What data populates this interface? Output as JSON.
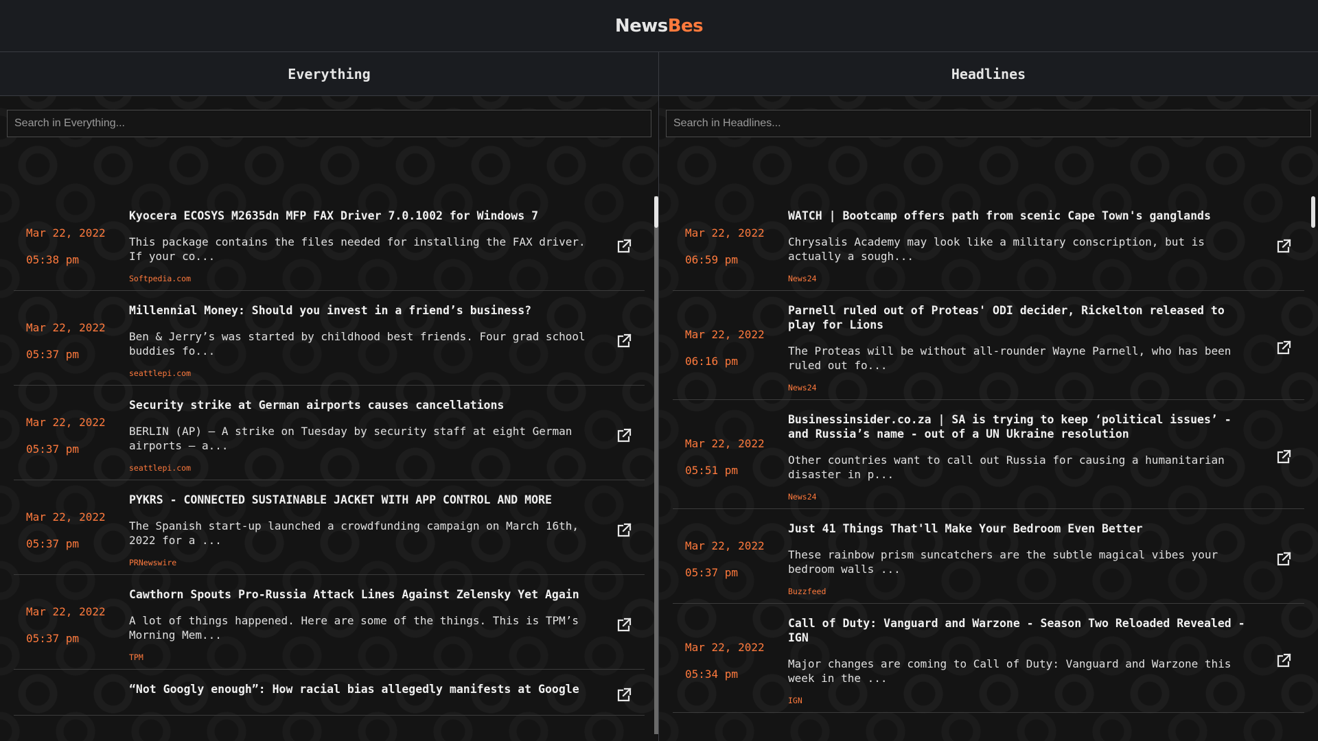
{
  "brand": {
    "part1": "News",
    "part2": "Bes",
    "accent": "#ff7a3d"
  },
  "everything": {
    "heading": "Everything",
    "search_placeholder": "Search in Everything...",
    "items": [
      {
        "date": "Mar 22, 2022",
        "time": "05:38 pm",
        "title": "Kyocera ECOSYS M2635dn MFP FAX Driver 7.0.1002 for Windows 7",
        "desc": "This package contains the files needed for installing the FAX driver. If your co...",
        "source": "Softpedia.com"
      },
      {
        "date": "Mar 22, 2022",
        "time": "05:37 pm",
        "title": "Millennial Money: Should you invest in a friend’s business?",
        "desc": "Ben & Jerry’s was started by childhood best friends. Four grad school buddies fo...",
        "source": "seattlepi.com"
      },
      {
        "date": "Mar 22, 2022",
        "time": "05:37 pm",
        "title": "Security strike at German airports causes cancellations",
        "desc": "BERLIN (AP) — A strike on Tuesday by security staff at eight German airports — a...",
        "source": "seattlepi.com"
      },
      {
        "date": "Mar 22, 2022",
        "time": "05:37 pm",
        "title": "PYKRS - CONNECTED SUSTAINABLE JACKET WITH APP CONTROL AND MORE",
        "desc": "The Spanish start-up launched a crowdfunding campaign on March 16th, 2022 for a ...",
        "source": "PRNewswire"
      },
      {
        "date": "Mar 22, 2022",
        "time": "05:37 pm",
        "title": "Cawthorn Spouts Pro-Russia Attack Lines Against Zelensky Yet Again",
        "desc": "A lot of things happened. Here are some of the things. This is TPM’s Morning Mem...",
        "source": "TPM"
      },
      {
        "date": "",
        "time": "",
        "title": "“Not Googly enough”: How racial bias allegedly manifests at Google",
        "desc": "",
        "source": ""
      }
    ]
  },
  "headlines": {
    "heading": "Headlines",
    "search_placeholder": "Search in Headlines...",
    "items": [
      {
        "date": "Mar 22, 2022",
        "time": "06:59 pm",
        "title": "WATCH | Bootcamp offers path from scenic Cape Town's ganglands",
        "desc": "Chrysalis Academy may look like a military conscription, but is actually a sough...",
        "source": "News24"
      },
      {
        "date": "Mar 22, 2022",
        "time": "06:16 pm",
        "title": "Parnell ruled out of Proteas' ODI decider, Rickelton released to play for Lions",
        "desc": "The Proteas will be without all-rounder Wayne Parnell, who has been ruled out fo...",
        "source": "News24"
      },
      {
        "date": "Mar 22, 2022",
        "time": "05:51 pm",
        "title": "Businessinsider.co.za | SA is trying to keep ‘political issues’ - and Russia’s name - out of a UN Ukraine resolution",
        "desc": "Other countries want to call out Russia for causing a humanitarian disaster in p...",
        "source": "News24"
      },
      {
        "date": "Mar 22, 2022",
        "time": "05:37 pm",
        "title": "Just 41 Things That'll Make Your Bedroom Even Better",
        "desc": "These rainbow prism suncatchers are the subtle magical vibes your bedroom walls ...",
        "source": "Buzzfeed"
      },
      {
        "date": "Mar 22, 2022",
        "time": "05:34 pm",
        "title": "Call of Duty: Vanguard and Warzone - Season Two Reloaded Revealed - IGN",
        "desc": "Major changes are coming to Call of Duty: Vanguard and Warzone this week in the ...",
        "source": "IGN"
      }
    ]
  }
}
